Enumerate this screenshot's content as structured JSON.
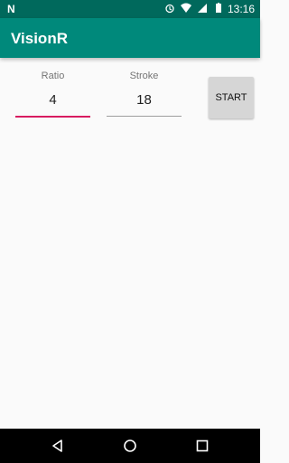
{
  "status_bar": {
    "time": "13:16",
    "icons": [
      "notification-n-icon",
      "alarm-icon",
      "wifi-icon",
      "signal-icon",
      "battery-icon"
    ]
  },
  "app_bar": {
    "title": "VisionR"
  },
  "form": {
    "ratio": {
      "label": "Ratio",
      "value": "4"
    },
    "stroke": {
      "label": "Stroke",
      "value": "18"
    },
    "start_label": "START"
  },
  "navigation_bar": {
    "buttons": [
      "back-icon",
      "home-icon",
      "recents-icon"
    ]
  },
  "colors": {
    "status_bar": "#00695c",
    "app_bar": "#00897b",
    "accent": "#d81b60"
  }
}
